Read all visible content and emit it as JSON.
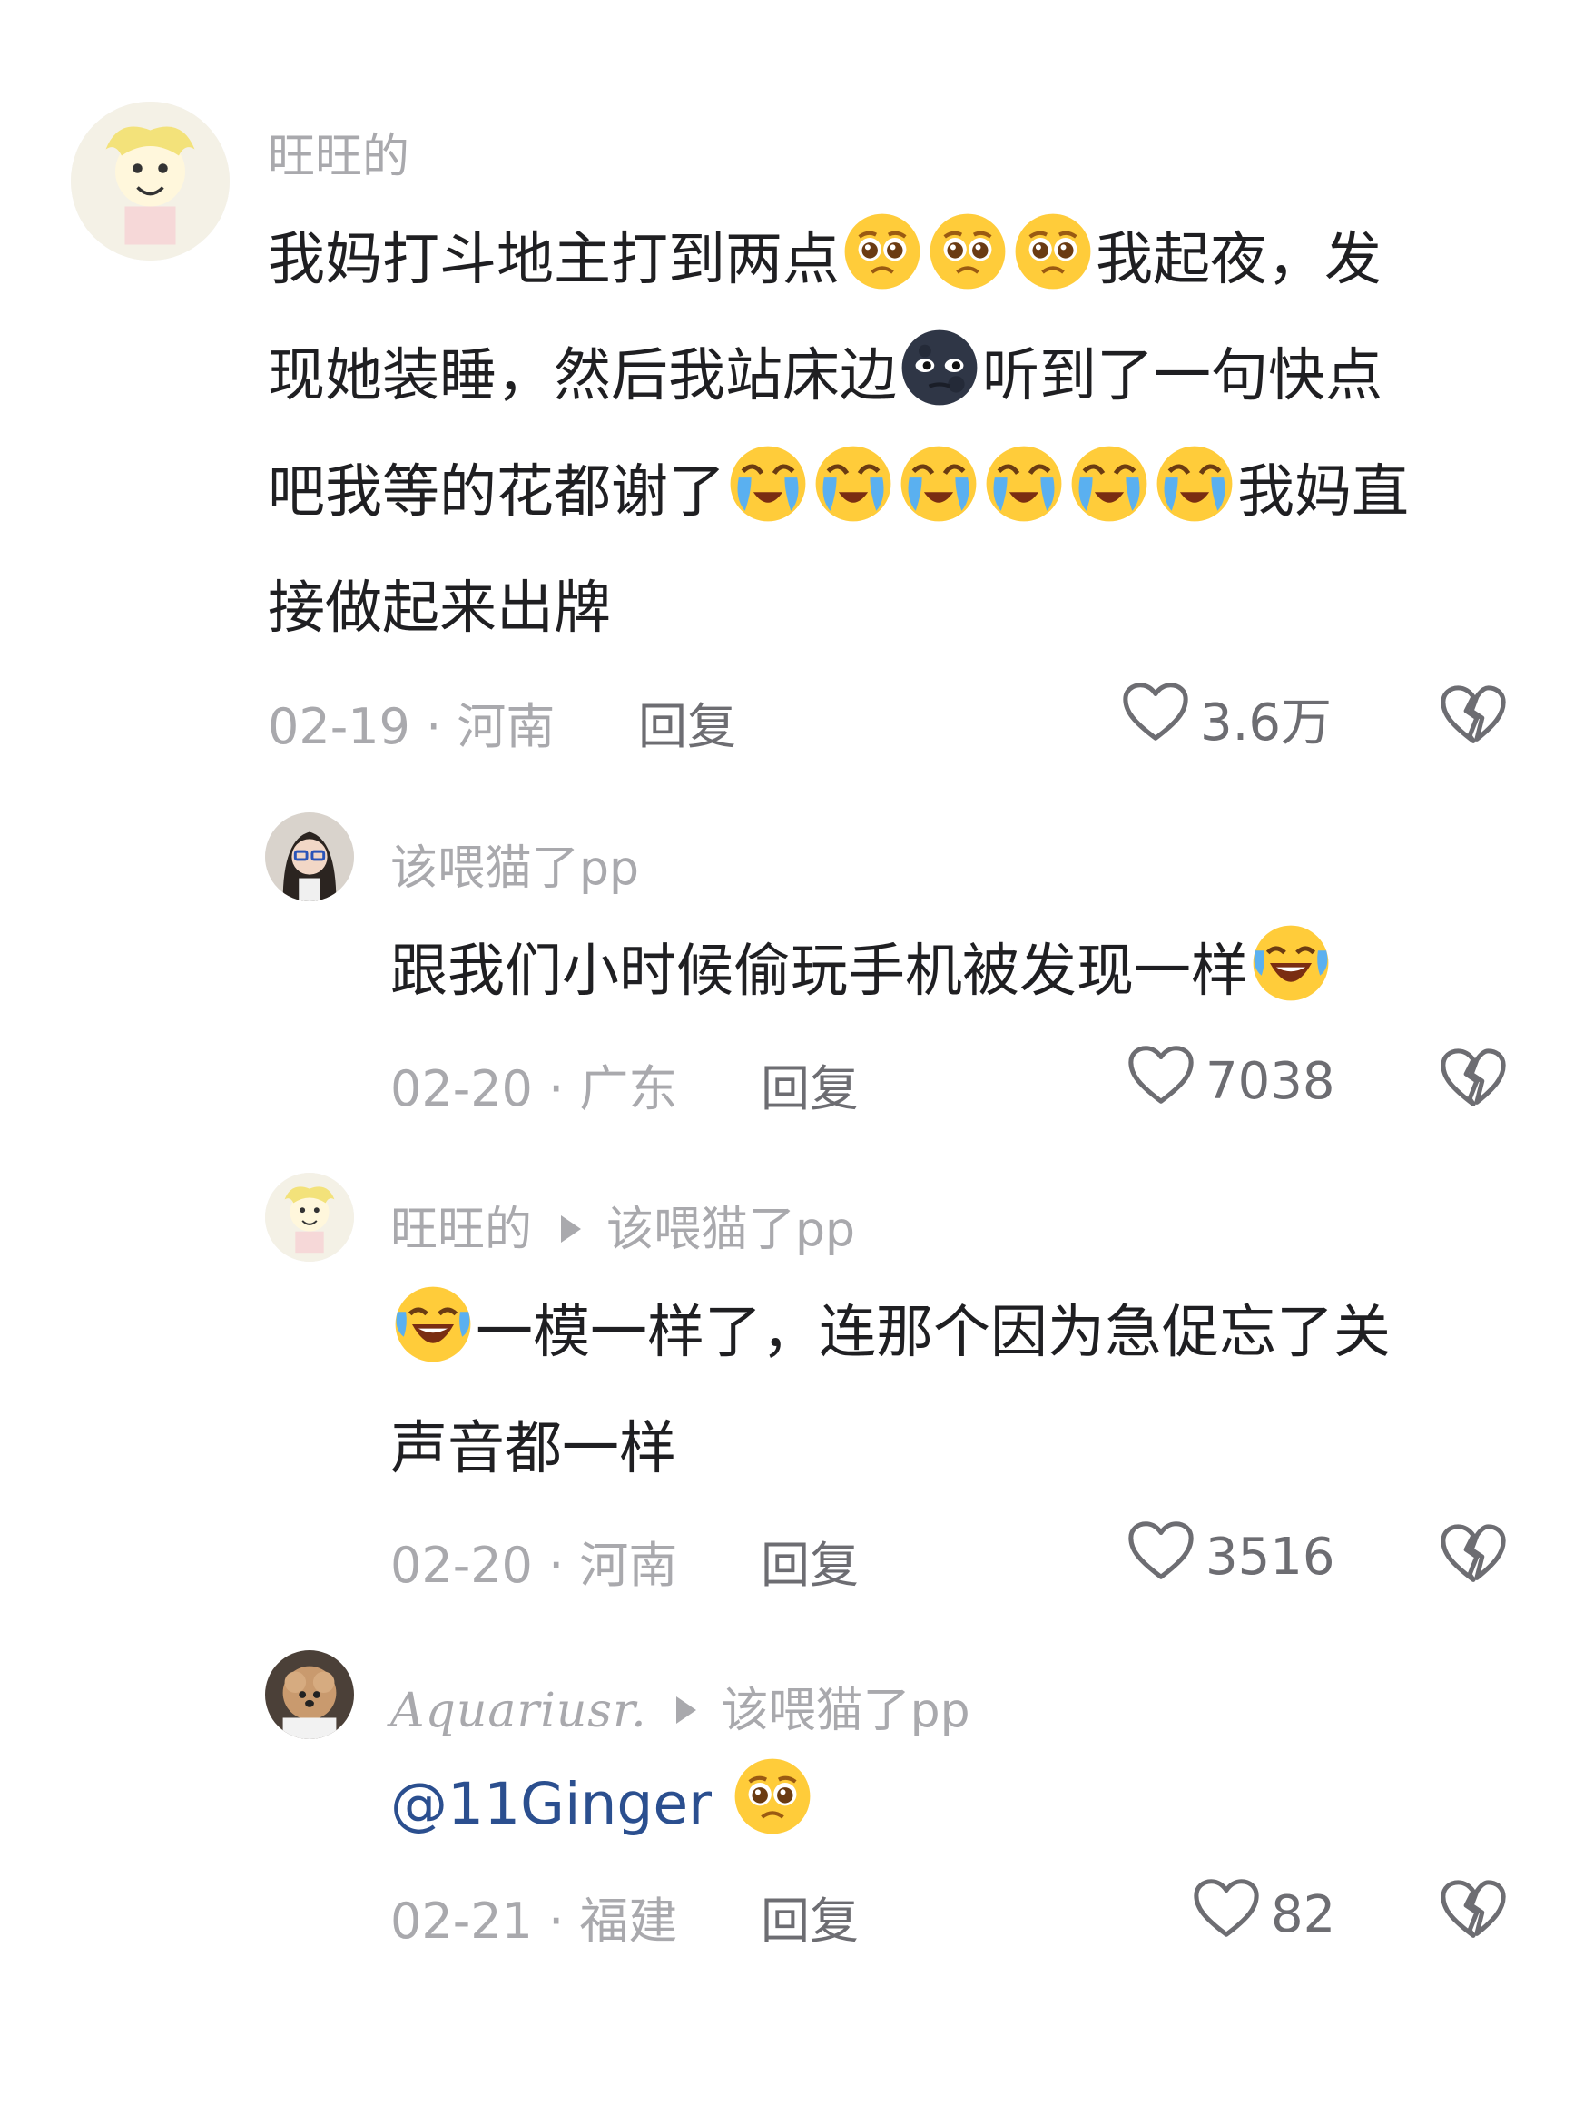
{
  "comments": [
    {
      "username": "旺旺的",
      "lines": [
        [
          {
            "t": "text",
            "v": "我妈打斗地主打到两点"
          },
          {
            "t": "emoji",
            "v": "pleading"
          },
          {
            "t": "emoji",
            "v": "pleading"
          },
          {
            "t": "emoji",
            "v": "pleading"
          },
          {
            "t": "text",
            "v": "我起夜，发"
          }
        ],
        [
          {
            "t": "text",
            "v": "现她装睡，然后我站床边"
          },
          {
            "t": "emoji",
            "v": "new-moon-face"
          },
          {
            "t": "text",
            "v": "听到了一句快点"
          }
        ],
        [
          {
            "t": "text",
            "v": "吧我等的花都谢了"
          },
          {
            "t": "emoji",
            "v": "crying"
          },
          {
            "t": "emoji",
            "v": "crying"
          },
          {
            "t": "emoji",
            "v": "crying"
          },
          {
            "t": "emoji",
            "v": "crying"
          },
          {
            "t": "emoji",
            "v": "crying"
          },
          {
            "t": "emoji",
            "v": "crying"
          },
          {
            "t": "text",
            "v": "我妈直"
          }
        ],
        [
          {
            "t": "text",
            "v": "接做起来出牌"
          }
        ]
      ],
      "date": "02-19",
      "location": "河南",
      "meta": "02-19 · 河南",
      "reply_label": "回复",
      "likes": "3.6万"
    },
    {
      "username": "该喂猫了pp",
      "lines": [
        [
          {
            "t": "text",
            "v": "跟我们小时候偷玩手机被发现一样"
          },
          {
            "t": "emoji",
            "v": "laugh-cry"
          }
        ]
      ],
      "meta": "02-20 · 广东",
      "reply_label": "回复",
      "likes": "7038"
    },
    {
      "username": "旺旺的",
      "reply_to": "该喂猫了pp",
      "lines": [
        [
          {
            "t": "emoji",
            "v": "laugh-cry"
          },
          {
            "t": "text",
            "v": "一模一样了，连那个因为急促忘了关"
          }
        ],
        [
          {
            "t": "text",
            "v": "声音都一样"
          }
        ]
      ],
      "meta": "02-20 · 河南",
      "reply_label": "回复",
      "likes": "3516"
    },
    {
      "username": "Aquariusr.",
      "reply_to": "该喂猫了pp",
      "lines": [
        [
          {
            "t": "mention",
            "v": "@11Ginger"
          },
          {
            "t": "text",
            "v": " "
          },
          {
            "t": "emoji",
            "v": "pleading"
          }
        ]
      ],
      "meta": "02-21 · 福建",
      "reply_label": "回复",
      "likes": "82"
    }
  ],
  "icons": {
    "like": "heart-outline-icon",
    "dislike": "broken-heart-icon",
    "reply_arrow": "triangle-right-icon"
  },
  "colors": {
    "username": "#a9a9ad",
    "text": "#1f1f22",
    "mention": "#2b4f8f",
    "emoji_yellow": "#ffcc3a"
  }
}
